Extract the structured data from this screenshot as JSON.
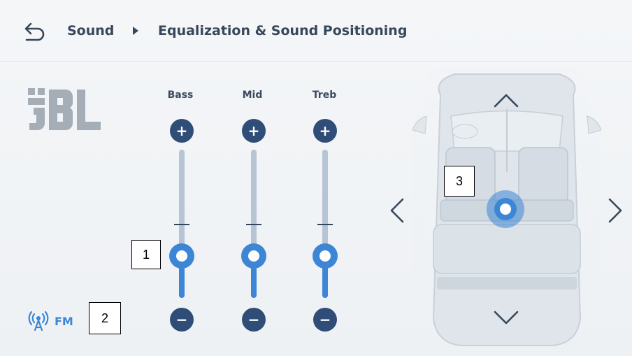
{
  "header": {
    "crumb_parent": "Sound",
    "crumb_current": "Equalization & Sound Positioning"
  },
  "logo": {
    "text": "JBL"
  },
  "equalizer": {
    "bands": [
      {
        "label": "Bass",
        "plus": "+",
        "minus": "−",
        "level": 0.3
      },
      {
        "label": "Mid",
        "plus": "+",
        "minus": "−",
        "level": 0.3
      },
      {
        "label": "Treb",
        "plus": "+",
        "minus": "−",
        "level": 0.3
      }
    ]
  },
  "source": {
    "label": "FM",
    "icon": "radio-broadcast-icon"
  },
  "callouts": {
    "c1": "1",
    "c2": "2",
    "c3": "3"
  },
  "positioning": {
    "icons": [
      "chevron-up-icon",
      "chevron-down-icon",
      "chevron-left-icon",
      "chevron-right-icon"
    ]
  },
  "colors": {
    "accent": "#3d86d6",
    "button": "#2f4d77",
    "text": "#37475a"
  }
}
